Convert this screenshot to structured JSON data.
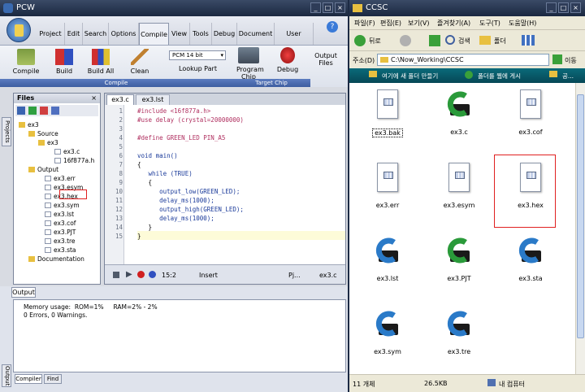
{
  "pcw": {
    "title": "PCW",
    "tabs": [
      "Project",
      "Edit",
      "Search",
      "Options",
      "Compile",
      "View",
      "Tools",
      "Debug",
      "Document",
      "User Toolbar"
    ],
    "active_tab": "Compile",
    "ribbon": {
      "compile": "Compile",
      "build": "Build",
      "build_all": "Build All",
      "clean": "Clean",
      "device": "PCM 14 bit",
      "lookup": "Lookup Part",
      "program_chip": "Program Chip",
      "debug": "Debug",
      "output_files": "Output Files",
      "group_compile": "Compile",
      "group_target": "Target Chip"
    },
    "files_pane": {
      "title": "Files",
      "side_tab": "Projects",
      "tree": [
        "ex3",
        "Source",
        "ex3",
        "ex3.c",
        "16f877a.h",
        "Output",
        "ex3.err",
        "ex3.esym",
        "ex3.hex",
        "ex3.sym",
        "ex3.lst",
        "ex3.cof",
        "ex3.PJT",
        "ex3.tre",
        "ex3.sta",
        "Documentation"
      ]
    },
    "editor": {
      "tabs": [
        "ex3.c",
        "ex3.lst"
      ],
      "lines": [
        {
          "n": "1",
          "t": "#include <16f877a.h>",
          "c": "#b03060"
        },
        {
          "n": "2",
          "t": "#use delay (crystal=20000000)",
          "c": "#b03060"
        },
        {
          "n": "3",
          "t": "",
          "c": "#000"
        },
        {
          "n": "4",
          "t": "#define GREEN_LED PIN_A5",
          "c": "#b03060"
        },
        {
          "n": "5",
          "t": "",
          "c": "#000"
        },
        {
          "n": "6",
          "t": "void main()",
          "c": "#1a3a9a"
        },
        {
          "n": "7",
          "t": "{",
          "c": "#000"
        },
        {
          "n": "8",
          "t": "   while (TRUE)",
          "c": "#1a3a9a"
        },
        {
          "n": "9",
          "t": "   {",
          "c": "#000"
        },
        {
          "n": "10",
          "t": "      output_low(GREEN_LED);",
          "c": "#1a3a9a"
        },
        {
          "n": "11",
          "t": "      delay_ms(1000);",
          "c": "#1a3a9a"
        },
        {
          "n": "12",
          "t": "      output_high(GREEN_LED);",
          "c": "#1a3a9a"
        },
        {
          "n": "13",
          "t": "      delay_ms(1000);",
          "c": "#1a3a9a"
        },
        {
          "n": "14",
          "t": "   }",
          "c": "#000"
        },
        {
          "n": "15",
          "t": "}",
          "c": "#000"
        }
      ],
      "status": {
        "pos": "15:2",
        "mode": "Insert",
        "right1": "Pj...",
        "right2": "ex3.c"
      }
    },
    "output": {
      "title": "Output",
      "line1": "Memory usage:  ROM=1%     RAM=2% - 2%",
      "line2": "0 Errors,  0 Warnings.",
      "tab1": "Compiler",
      "tab2": "Find",
      "side_tab": "Output"
    }
  },
  "explorer": {
    "title": "CCSC",
    "menu": [
      "파일(F)",
      "편집(E)",
      "보기(V)",
      "즐겨찾기(A)",
      "도구(T)",
      "도움말(H)"
    ],
    "back": "뒤로",
    "search": "검색",
    "folders": "폴더",
    "address_label": "주소(D)",
    "address": "C:\\Now_Working\\CCSC",
    "go": "이동",
    "tasks": [
      "여기에 새 폴더 만들기",
      "폴더를 웹에 게시",
      "공..."
    ],
    "files": [
      {
        "name": "ex3.bak",
        "type": "doc"
      },
      {
        "name": "ex3.c",
        "type": "c-green"
      },
      {
        "name": "ex3.cof",
        "type": "doc"
      },
      {
        "name": "ex3.err",
        "type": "doc"
      },
      {
        "name": "ex3.esym",
        "type": "doc"
      },
      {
        "name": "ex3.hex",
        "type": "doc"
      },
      {
        "name": "ex3.lst",
        "type": "c-blue"
      },
      {
        "name": "ex3.PJT",
        "type": "c-green"
      },
      {
        "name": "ex3.sta",
        "type": "c-blue"
      },
      {
        "name": "ex3.sym",
        "type": "c-blue"
      },
      {
        "name": "ex3.tre",
        "type": "c-blue"
      }
    ],
    "status": {
      "count": "11 개체",
      "size": "26.5KB",
      "location": "내 컴퓨터"
    }
  }
}
